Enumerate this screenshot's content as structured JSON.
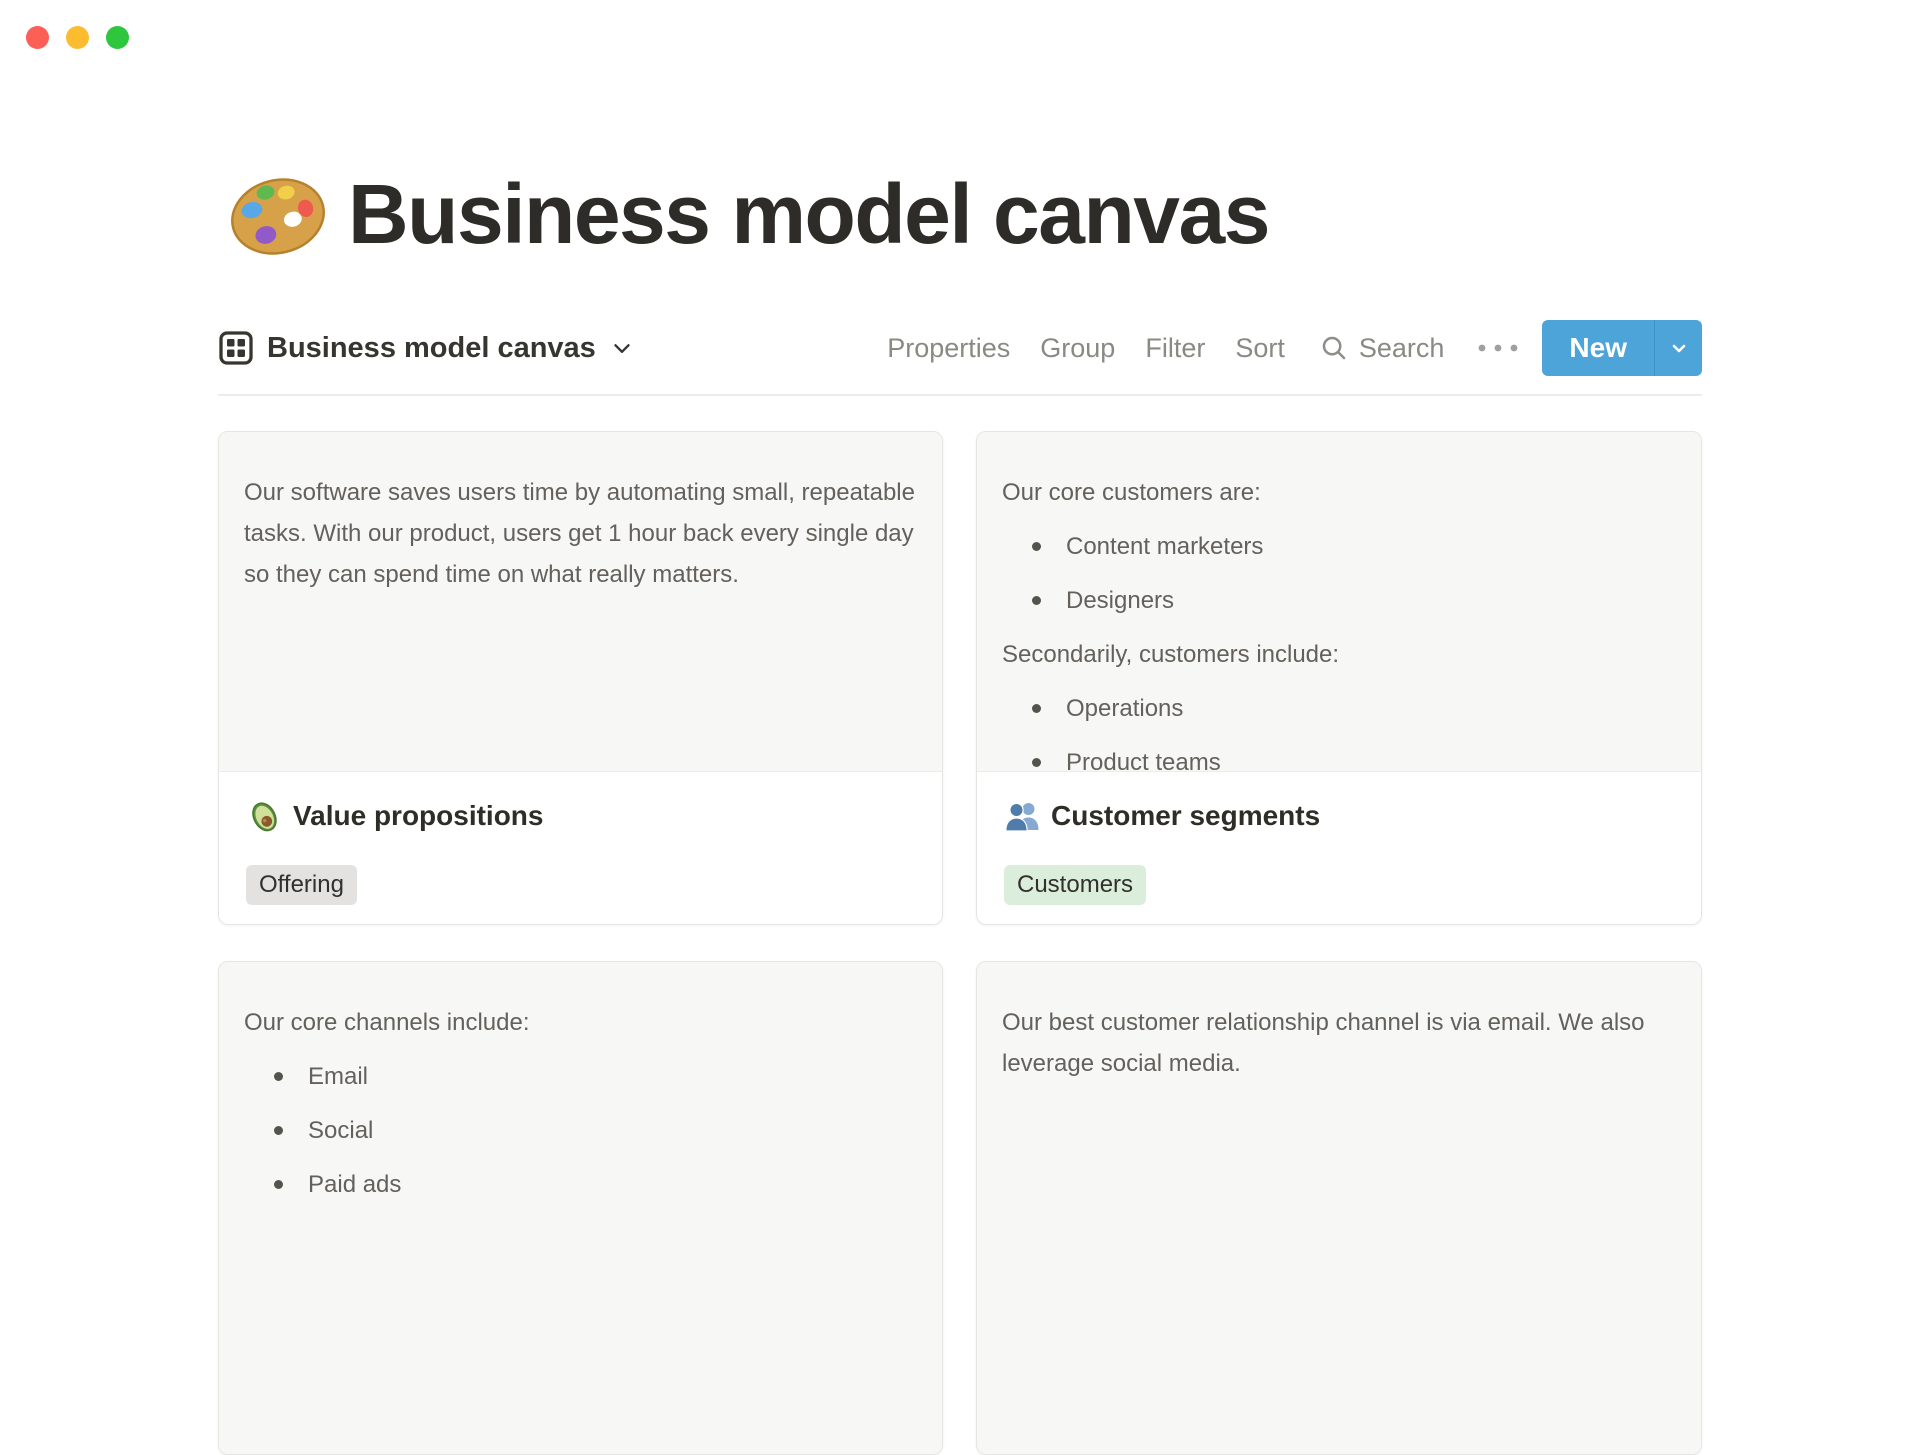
{
  "window": {
    "traffic_lights": [
      "close",
      "minimize",
      "zoom"
    ]
  },
  "page": {
    "icon": "palette-emoji",
    "title": "Business model canvas"
  },
  "toolbar": {
    "view": {
      "icon": "gallery-view-icon",
      "label": "Business model canvas"
    },
    "actions": [
      "Properties",
      "Group",
      "Filter",
      "Sort"
    ],
    "search_label": "Search",
    "more_icon": "ellipsis-icon",
    "new_button": {
      "label": "New",
      "color": "#4da4d9"
    }
  },
  "cards": [
    {
      "title": "Value propositions",
      "emoji": "avocado-emoji",
      "preview_blocks": [
        {
          "type": "paragraph",
          "text": "Our software saves users time by automating small, repeatable tasks. With our product, users get 1 hour back every single day so they can spend time on what really matters."
        }
      ],
      "tags": [
        {
          "label": "Offering",
          "color": "gray"
        }
      ]
    },
    {
      "title": "Customer segments",
      "emoji": "busts-emoji",
      "preview_blocks": [
        {
          "type": "paragraph",
          "text": "Our core customers are:"
        },
        {
          "type": "bullets",
          "items": [
            "Content marketers",
            "Designers"
          ]
        },
        {
          "type": "paragraph",
          "text": "Secondarily, customers include:"
        },
        {
          "type": "bullets",
          "items": [
            "Operations",
            "Product teams"
          ]
        }
      ],
      "tags": [
        {
          "label": "Customers",
          "color": "green"
        }
      ]
    },
    {
      "preview_blocks": [
        {
          "type": "paragraph",
          "text": "Our core channels include:"
        },
        {
          "type": "bullets",
          "items": [
            "Email",
            "Social",
            "Paid ads"
          ]
        }
      ]
    },
    {
      "preview_blocks": [
        {
          "type": "paragraph",
          "text": "Our best customer relationship channel is via email. We also leverage social media."
        }
      ]
    }
  ],
  "colors": {
    "accent_blue": "#4da4d9",
    "tag_gray_bg": "#e3e2e0",
    "tag_green_bg": "#dbeddb",
    "preview_bg": "#f7f7f5",
    "card_border": "#e6e5e2",
    "text_dark": "#2f2d28",
    "text_gray": "#64615c",
    "toolbar_gray": "#8a8984",
    "traffic_red": "#fb5f55",
    "traffic_yellow": "#fcbc2f",
    "traffic_green": "#2dc63c"
  }
}
